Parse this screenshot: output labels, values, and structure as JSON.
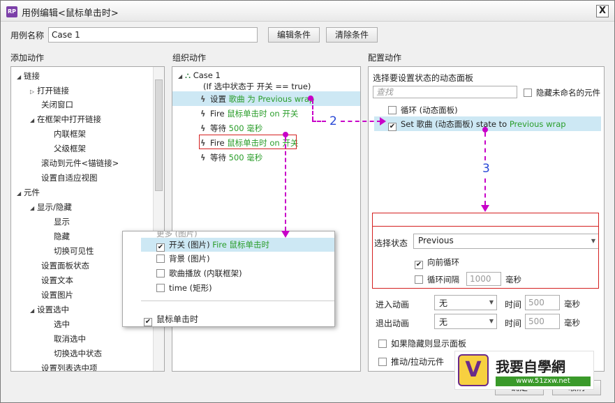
{
  "window": {
    "title": "用例编辑<鼠标单击时>",
    "icon": "RP",
    "close": "X"
  },
  "case": {
    "label": "用例名称",
    "value": "Case 1",
    "edit_btn": "编辑条件",
    "clear_btn": "清除条件"
  },
  "sections": {
    "add": "添加动作",
    "organize": "组织动作",
    "config": "配置动作"
  },
  "add_tree": [
    "链接",
    "打开链接",
    "关闭窗口",
    "在框架中打开链接",
    "内联框架",
    "父级框架",
    "滚动到元件<锚链接>",
    "设置自适应视图",
    "元件",
    "显示/隐藏",
    "显示",
    "隐藏",
    "切换可见性",
    "设置面板状态",
    "设置文本",
    "设置图片",
    "设置选中",
    "选中",
    "取消选中",
    "切换选中状态",
    "设置列表选中项"
  ],
  "organize": {
    "case": "Case 1",
    "condition": "(If 选中状态于 开关 == true)",
    "actions": [
      {
        "a": "设置 ",
        "g": "歌曲 为 Previous wrap"
      },
      {
        "a": "Fire ",
        "g": "鼠标单击时 on 开关"
      },
      {
        "a": "等待 ",
        "g": "500 毫秒"
      },
      {
        "a": "Fire ",
        "g": "鼠标单击时 on 开关"
      },
      {
        "a": "等待 ",
        "g": "500 毫秒"
      }
    ]
  },
  "popup": {
    "partial": "更多 (图片)",
    "items": [
      {
        "label": "开关 (图片) ",
        "g": "Fire 鼠标单击时",
        "checked": true
      },
      {
        "label": "背景 (图片)",
        "g": "",
        "checked": false
      },
      {
        "label": "歌曲播放 (内联框架)",
        "g": "",
        "checked": false
      },
      {
        "label": "time (矩形)",
        "g": "",
        "checked": false
      }
    ],
    "event": "鼠标单击时"
  },
  "config": {
    "heading": "选择要设置状态的动态面板",
    "search_placeholder": "查找",
    "hide_unnamed": "隐藏未命名的元件",
    "list": [
      {
        "text": "循环 (动态面板)",
        "checked": false
      },
      {
        "text": "Set 歌曲 (动态面板) state to ",
        "g": "Previous wrap",
        "checked": true
      }
    ],
    "state_label": "选择状态",
    "state_value": "Previous",
    "forward_loop": "向前循环",
    "loop_interval": "循环间隔",
    "loop_value": "1000",
    "ms": "毫秒",
    "enter_anim": "进入动画",
    "exit_anim": "退出动画",
    "anim_value": "无",
    "time": "时间",
    "time_value": "500",
    "show_if_hidden": "如果隐藏则显示面板",
    "push_pull": "推动/拉动元件"
  },
  "steps": {
    "two": "2",
    "three": "3"
  },
  "watermark": {
    "brand": "我要自學網",
    "url": "www.51zxw.net"
  },
  "footer": {
    "ok": "确定",
    "cancel": "取消"
  }
}
